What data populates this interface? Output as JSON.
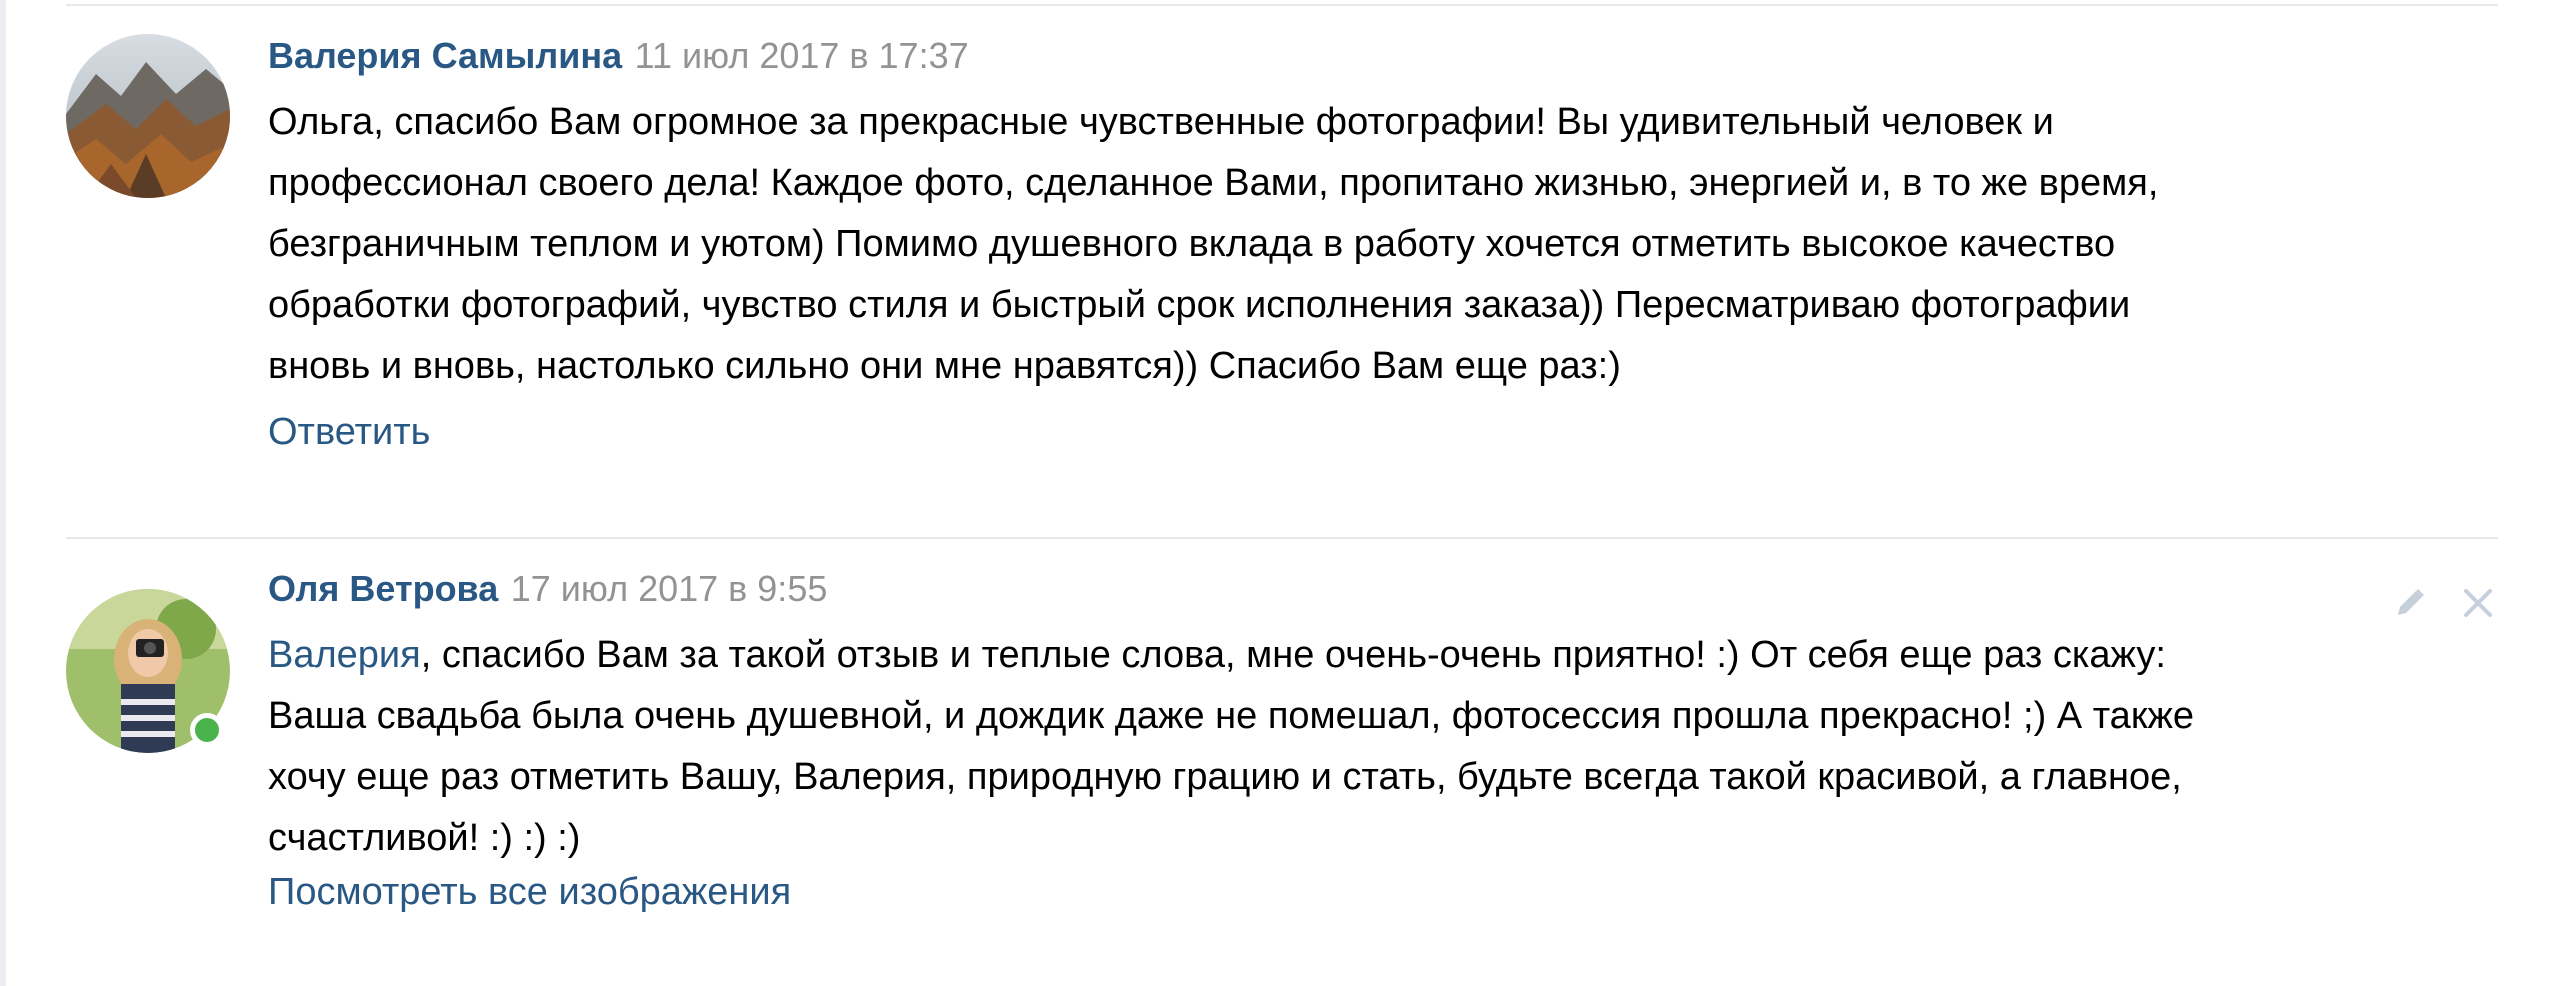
{
  "comments": [
    {
      "author": "Валерия Самылина",
      "date": "11 июл 2017 в 17:37",
      "lines": [
        "Ольга, спасибо Вам огромное за прекрасные чувственные фотографии! Вы удивительный человек и",
        "профессионал своего дела! Каждое фото, сделанное Вами, пропитано жизнью, энергией и, в то же время,",
        "безграничным теплом и уютом) Помимо душевного вклада в работу хочется отметить высокое качество",
        "обработки фотографий, чувство стиля и быстрый срок исполнения заказа)) Пересматриваю фотографии",
        "вновь и вновь, настолько сильно они мне нравятся)) Спасибо Вам еще раз:)"
      ],
      "reply_label": "Ответить"
    },
    {
      "author": "Оля Ветрова",
      "date": "17 июл 2017 в 9:55",
      "mention": "Валерия",
      "line1_rest": ", спасибо Вам за такой отзыв и теплые слова, мне очень-очень приятно! :) От себя еще раз скажу:",
      "lines": [
        "Ваша свадьба была очень душевной, и дождик даже не помешал, фотосессия прошла прекрасно! ;) А также",
        "хочу еще раз отметить Вашу, Валерия, природную грацию и стать, будьте всегда такой красивой, а главное,",
        "счастливой! :) :) :)"
      ],
      "view_images_label": "Посмотреть все изображения",
      "online": true,
      "actions": {
        "edit_icon": "pencil-icon",
        "delete_icon": "close-icon"
      }
    }
  ],
  "colors": {
    "link": "#2a5885",
    "date": "#939393",
    "text": "#000000",
    "divider": "#e7e8ec",
    "online": "#4bb34b",
    "icon": "#c5d0db"
  }
}
